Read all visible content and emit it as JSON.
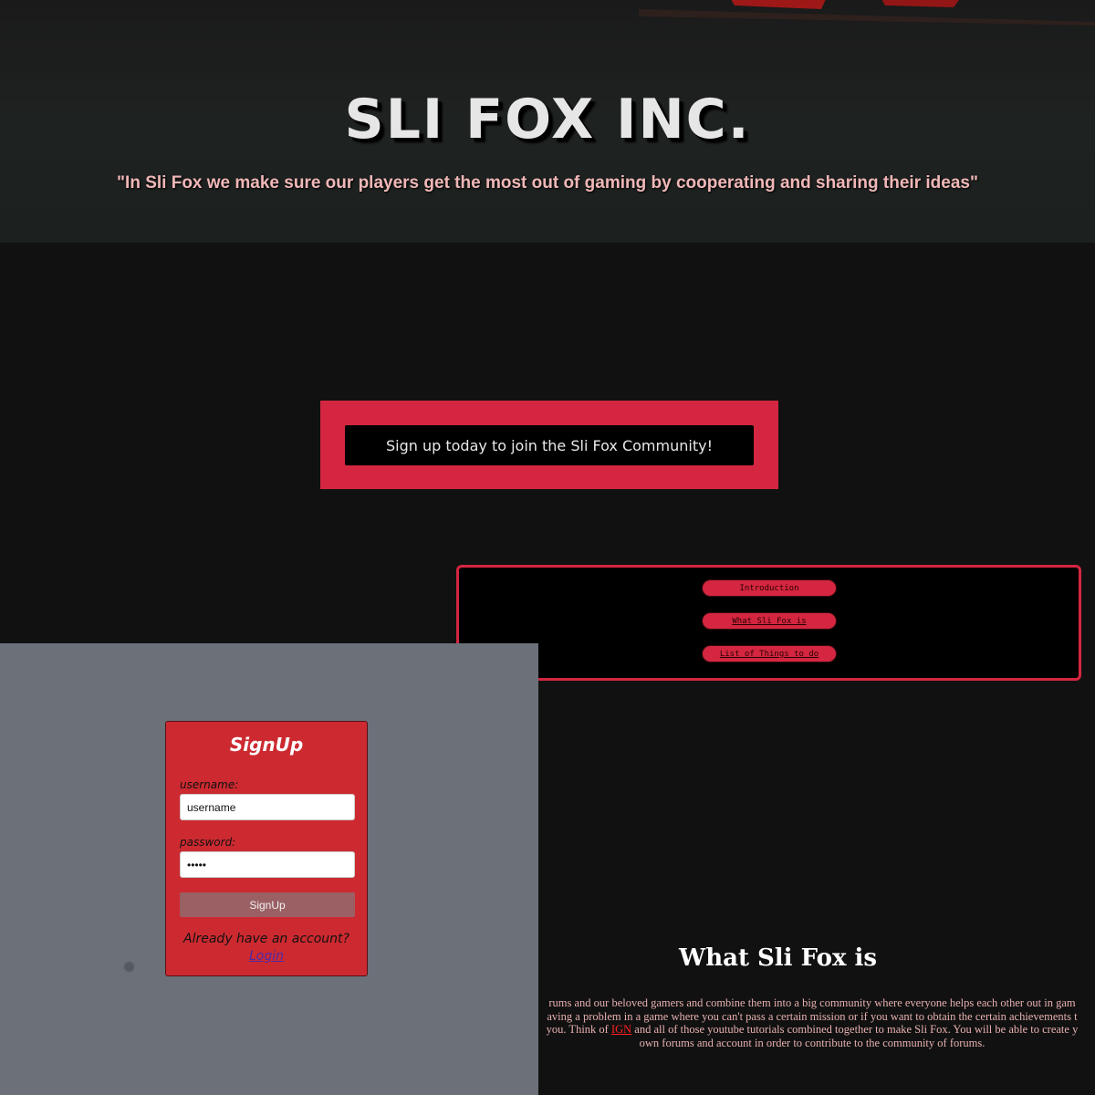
{
  "hero": {
    "title": "SLI FOX INC.",
    "quote": "\"In Sli Fox we make sure our players get the most out of gaming by cooperating and sharing their ideas\""
  },
  "cta": {
    "label": "Sign up today to join the Sli Fox Community!"
  },
  "nav": {
    "items": [
      {
        "label": "Introduction"
      },
      {
        "label": "What Sli Fox is"
      },
      {
        "label": "List of Things to do"
      }
    ]
  },
  "section": {
    "title": "What Sli Fox is",
    "line1": "rums and our beloved gamers and combine them into a big community where everyone helps each other out in gam",
    "line2": "aving a problem in a game where you can't pass a certain mission or if you want to obtain the certain achievements t",
    "line3_pre": "you. Think of ",
    "line3_link": "IGN",
    "line3_post": " and all of those youtube tutorials combined together to make Sli Fox. You will be able to create y",
    "line4": "own forums and account in order to contribute to the community of forums."
  },
  "signup": {
    "title": "SignUp",
    "username_label": "username:",
    "username_value": "username",
    "password_label": "password:",
    "password_value": "•••••",
    "button_label": "SignUp",
    "already_text": "Already have an account?",
    "login_label": "Login"
  },
  "colors": {
    "accent": "#d42640",
    "page_bg": "#111111",
    "signup_overlay": "#6b7079",
    "signup_card": "#cc2a30",
    "quote_text": "#f0b7b7",
    "body_text": "#e8b0b0"
  }
}
